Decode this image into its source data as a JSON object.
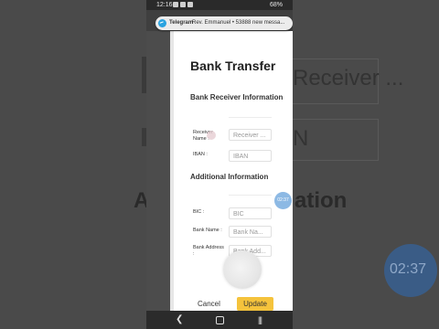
{
  "background": {
    "field_placeholder": "Receiver ...",
    "iban_text": "N",
    "section_fragment_a": "A",
    "section_fragment_b": "ation",
    "timer": "02:37"
  },
  "status_bar": {
    "time": "12:16",
    "battery": "68%"
  },
  "notification": {
    "app": "Telegram",
    "message": "Rev. Emmanuel • 53888 new messa..."
  },
  "form": {
    "title": "Bank Transfer",
    "receiver_section": {
      "heading": "Bank Receiver Information",
      "receiver_name_label": "Receiver Name :",
      "receiver_name_placeholder": "Receiver ...",
      "iban_label": "IBAN :",
      "iban_placeholder": "IBAN"
    },
    "additional_section": {
      "heading": "Additional Information",
      "bic_label": "BIC :",
      "bic_placeholder": "BIC",
      "bank_name_label": "Bank Name :",
      "bank_name_placeholder": "Bank Na...",
      "bank_address_label": "Bank Address :",
      "bank_address_placeholder": "Bank Add..."
    },
    "cancel_label": "Cancel",
    "update_label": "Update"
  },
  "timer_badge": "02:37",
  "colors": {
    "accent_update": "#f5c33c",
    "telegram": "#2aa3e0",
    "timer_badge": "#8db9e4"
  },
  "icons": [
    "telegram-icon",
    "back-icon",
    "home-icon",
    "recents-icon"
  ]
}
